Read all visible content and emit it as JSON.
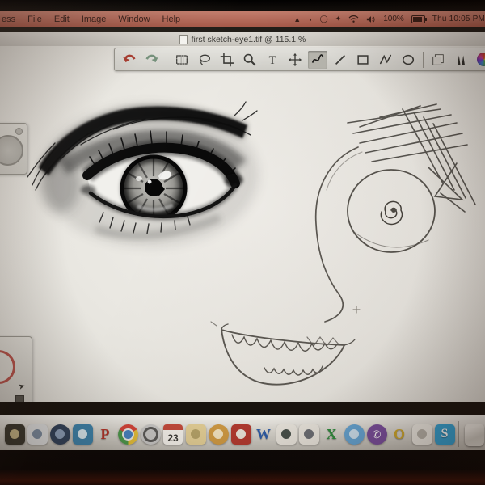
{
  "menu_bar": {
    "app_menu_cut": "ess",
    "menus": [
      "File",
      "Edit",
      "Image",
      "Window",
      "Help"
    ],
    "status_icons": [
      "alert-triangle-icon",
      "crescent-icon",
      "circle-icon",
      "spark-icon",
      "wifi-icon",
      "volume-icon"
    ],
    "battery_percent": "100%",
    "clock": "Thu 10:05 PM"
  },
  "window": {
    "title": "first sketch-eye1.tif @ 115.1 %"
  },
  "toolbar": {
    "tools": [
      {
        "id": "undo"
      },
      {
        "id": "redo"
      },
      {
        "id": "sep"
      },
      {
        "id": "select-rect"
      },
      {
        "id": "lasso"
      },
      {
        "id": "crop"
      },
      {
        "id": "zoom"
      },
      {
        "id": "text"
      },
      {
        "id": "move"
      },
      {
        "id": "curve",
        "selected": true
      },
      {
        "id": "line"
      },
      {
        "id": "rect"
      },
      {
        "id": "polyline"
      },
      {
        "id": "ellipse"
      },
      {
        "id": "sep"
      },
      {
        "id": "layers"
      },
      {
        "id": "brushes"
      },
      {
        "id": "colors"
      }
    ]
  },
  "canvas": {
    "subjects": [
      "realistic-eye-sketch",
      "doodle-face-with-scribble-hair-circle-eye-spiral-pupil-nose-curve-toothy-smile"
    ]
  },
  "dock": {
    "items": [
      {
        "name": "dark-terminal",
        "type": "square",
        "color": "#3c3a30",
        "detail": "#c9b98a"
      },
      {
        "name": "photos",
        "type": "square",
        "color": "#e2e4e4",
        "detail": "#7d8fa3"
      },
      {
        "name": "navy-globe",
        "type": "circle",
        "color": "#33445c",
        "detail": "#8fa3bd"
      },
      {
        "name": "blue-banner",
        "type": "square",
        "color": "#3e85ad",
        "detail": "#dcedf4"
      },
      {
        "name": "parallels",
        "type": "letter",
        "letter": "P",
        "color": "#b5352a"
      },
      {
        "name": "chrome",
        "type": "chrome"
      },
      {
        "name": "quicktime",
        "type": "quicktime",
        "color": "#c9c9c7"
      },
      {
        "name": "calendar",
        "type": "calendar",
        "number": "23"
      },
      {
        "name": "notes",
        "type": "square",
        "color": "#e3cf96",
        "detail": "#b5a369"
      },
      {
        "name": "amber-book",
        "type": "circle",
        "color": "#cf9a43",
        "detail": "#f2e3c0"
      },
      {
        "name": "red-curtain",
        "type": "square",
        "color": "#b23a30",
        "detail": "#e8e4da"
      },
      {
        "name": "word",
        "type": "letter",
        "letter": "W",
        "color": "#2b5ca8"
      },
      {
        "name": "white-scene",
        "type": "square",
        "color": "#e9e6de",
        "detail": "#47514b"
      },
      {
        "name": "white-badge",
        "type": "square",
        "color": "#e9e6de",
        "detail": "#6b6f75"
      },
      {
        "name": "excel",
        "type": "letter",
        "letter": "X",
        "color": "#2f8f3f"
      },
      {
        "name": "globe-chat",
        "type": "circle",
        "color": "#66a7d6",
        "detail": "#cfe4f2"
      },
      {
        "name": "viber",
        "type": "viber",
        "color": "#7a4f9e"
      },
      {
        "name": "outlook",
        "type": "letter",
        "letter": "O",
        "color": "#cfa92c"
      },
      {
        "name": "paper",
        "type": "square",
        "color": "#efede6",
        "detail": "#b9b6ad"
      },
      {
        "name": "skype",
        "type": "skype",
        "letter": "S",
        "color": "#35a3d4"
      }
    ],
    "trash": {
      "name": "trash"
    }
  }
}
